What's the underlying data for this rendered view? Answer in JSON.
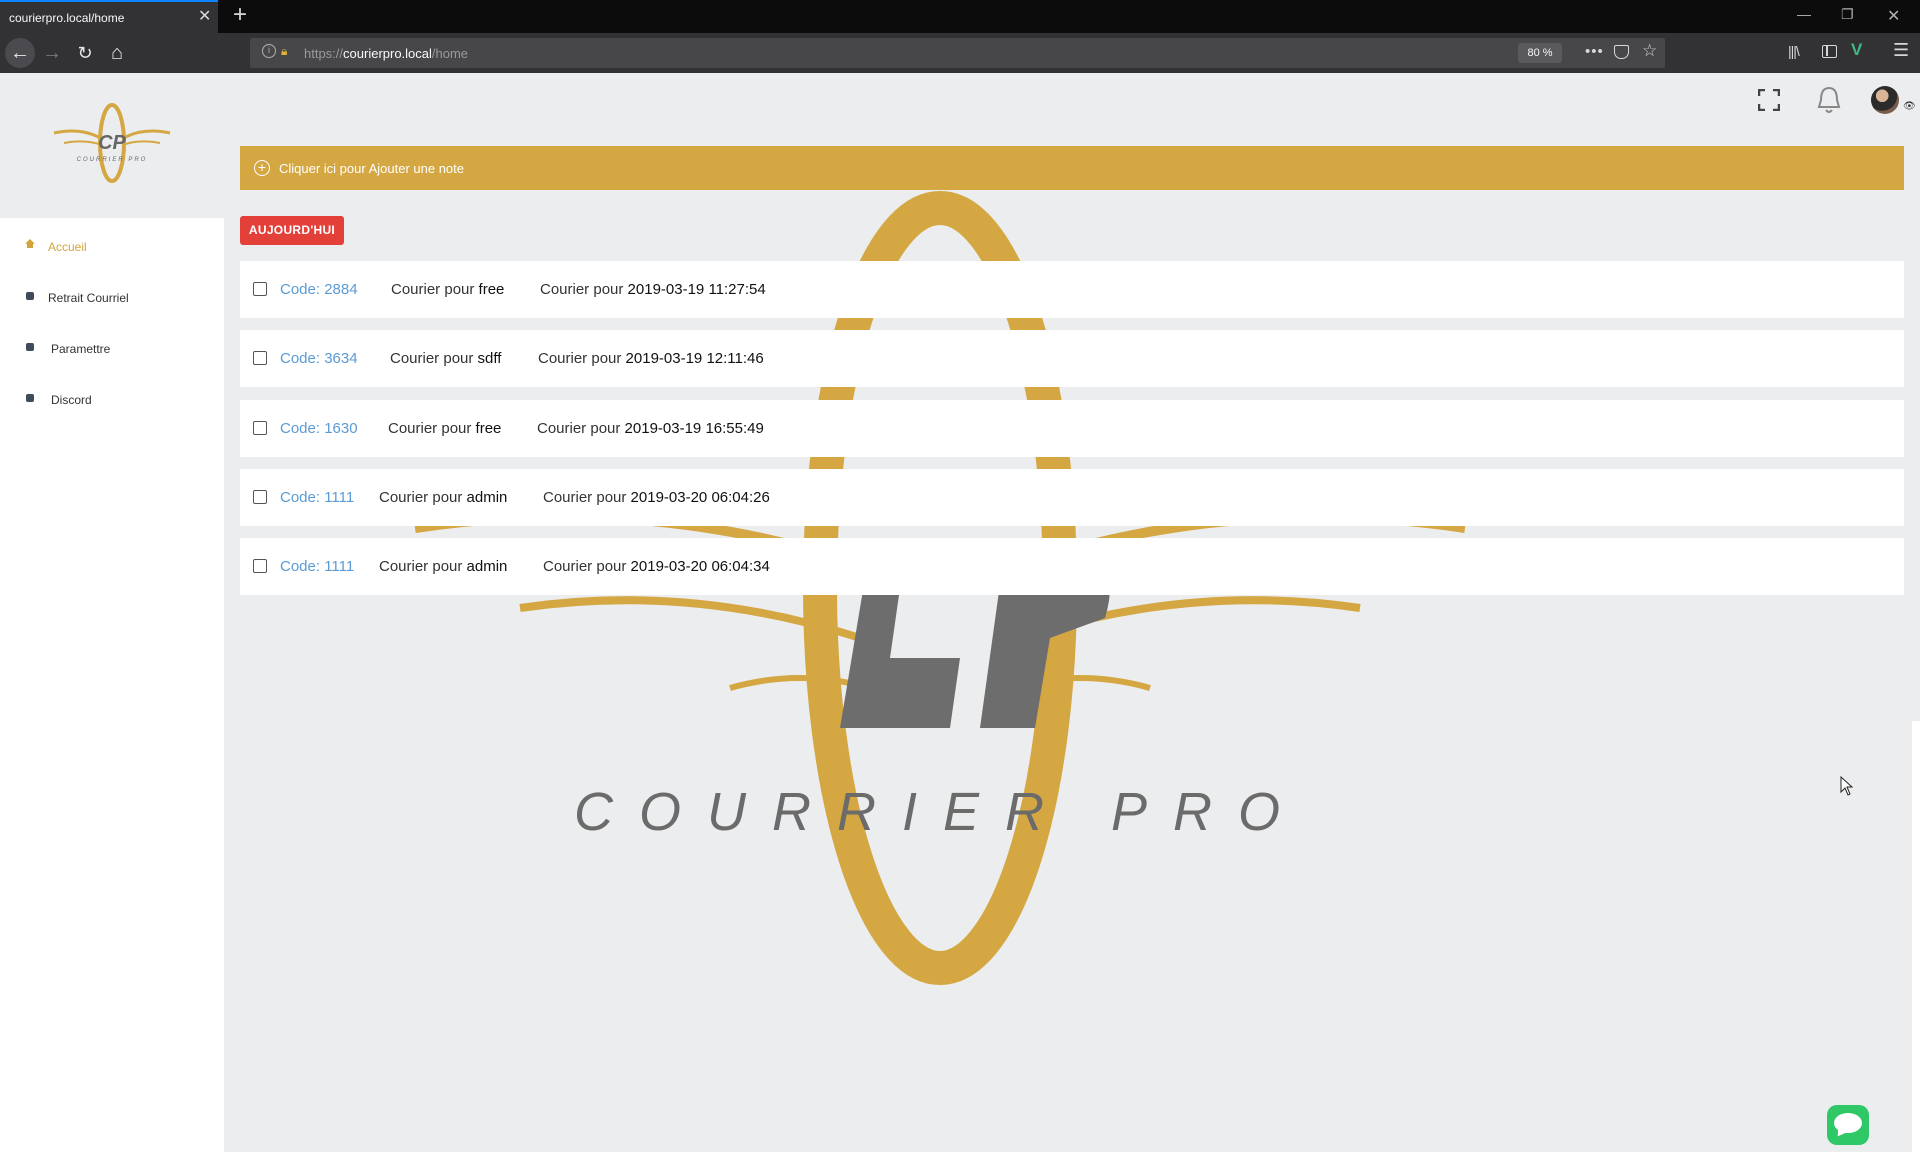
{
  "browser": {
    "tab_title": "courierpro.local/home",
    "url_scheme": "https://",
    "url_host": "courierpro.local",
    "url_path": "/home",
    "zoom": "80 %"
  },
  "app": {
    "brand_name": "COURRIER PRO",
    "logo_initials": "CP",
    "accent_color": "#d4a743",
    "danger_color": "#e4403a",
    "link_color": "#5b9bd5"
  },
  "sidebar": {
    "items": [
      {
        "label": "Accueil",
        "icon": "home-icon",
        "active": true
      },
      {
        "label": "Retrait Courriel",
        "icon": "app-icon",
        "active": false
      },
      {
        "label": "Paramettre",
        "icon": "app-icon",
        "active": false
      },
      {
        "label": "Discord",
        "icon": "app-icon",
        "active": false
      }
    ]
  },
  "note_bar": {
    "text": "Cliquer ici pour Ajouter une note"
  },
  "today_button": {
    "label": "AUJOURD'HUI"
  },
  "courier_prefix": "Courier pour",
  "couriers": [
    {
      "code": "Code: 2884",
      "recipient": "free",
      "date": "2019-03-19 11:27:54"
    },
    {
      "code": "Code: 3634",
      "recipient": "sdff",
      "date": "2019-03-19 12:11:46"
    },
    {
      "code": "Code: 1630",
      "recipient": "free",
      "date": "2019-03-19 16:55:49"
    },
    {
      "code": "Code: 1111",
      "recipient": "admin",
      "date": "2019-03-20 06:04:26"
    },
    {
      "code": "Code: 1111",
      "recipient": "admin",
      "date": "2019-03-20 06:04:34"
    }
  ]
}
